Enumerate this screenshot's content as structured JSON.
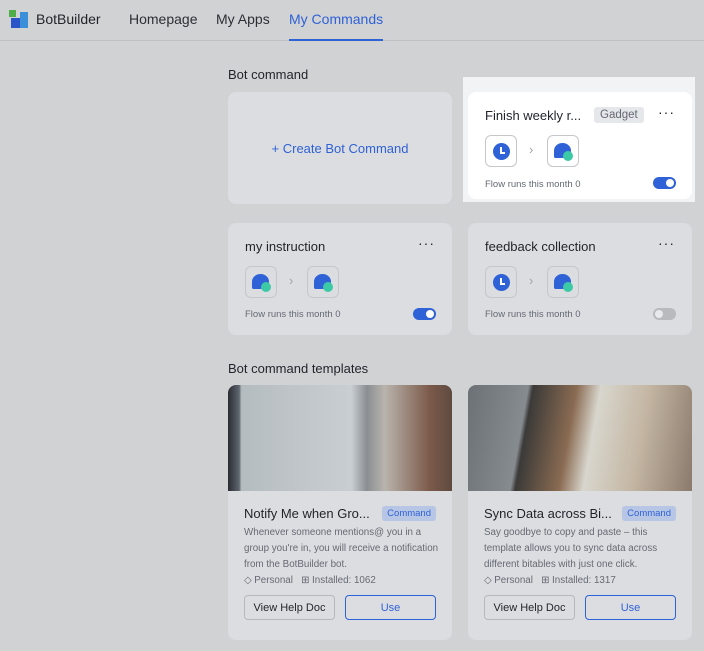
{
  "nav": {
    "brand": "BotBuilder",
    "tabs": [
      "Homepage",
      "My Apps",
      "My Commands"
    ],
    "active_tab": "My Commands"
  },
  "bot_command": {
    "title": "Bot command",
    "create_label": "+ Create Bot Command",
    "cards": [
      {
        "title": "Finish weekly r...",
        "badge": "Gadget",
        "trigger": "alarm-clock-icon",
        "action": "chat-bubble-icon",
        "flow": "Flow runs this month 0",
        "enabled": true
      },
      {
        "title": "my instruction",
        "trigger": "chat-bubble-icon",
        "action": "chat-bubble-icon",
        "flow": "Flow runs this month 0",
        "enabled": true
      },
      {
        "title": "feedback collection",
        "trigger": "alarm-clock-icon",
        "action": "chat-bubble-icon",
        "flow": "Flow runs this month 0",
        "enabled": false
      }
    ]
  },
  "templates": {
    "title": "Bot command templates",
    "items": [
      {
        "title": "Notify Me when Gro...",
        "badge": "Command",
        "desc": "Whenever someone mentions@ you in a group you're in, you will receive a notification from the BotBuilder bot.",
        "scope": "Personal",
        "installed": "Installed: 1062",
        "help": "View Help Doc",
        "use": "Use"
      },
      {
        "title": "Sync Data across Bi...",
        "badge": "Command",
        "desc": "Say goodbye to copy and paste – this template allows you to sync data across different bitables with just one click.",
        "scope": "Personal",
        "installed": "Installed: 1317",
        "help": "View Help Doc",
        "use": "Use"
      }
    ]
  },
  "colors": {
    "accent": "#2f62d6",
    "toggle_on": "#2f62d6",
    "highlight": "#ffffff"
  }
}
